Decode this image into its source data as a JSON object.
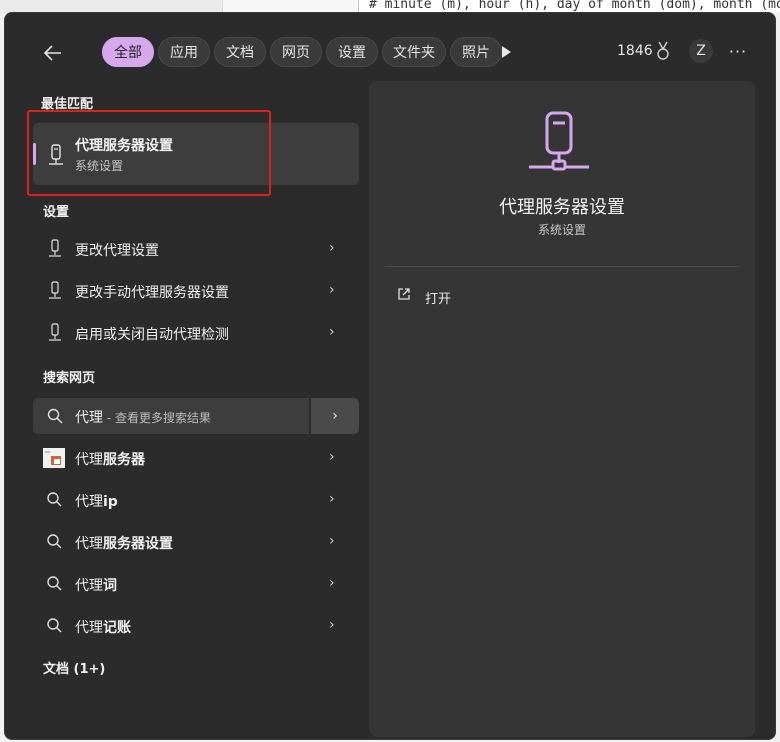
{
  "background": {
    "editor_line": "# minute (m), hour (h), day of month (dom), month (mon)"
  },
  "header": {
    "tabs": [
      {
        "label": "全部",
        "active": true
      },
      {
        "label": "应用",
        "active": false
      },
      {
        "label": "文档",
        "active": false
      },
      {
        "label": "网页",
        "active": false
      },
      {
        "label": "设置",
        "active": false
      },
      {
        "label": "文件夹",
        "active": false
      },
      {
        "label": "照片",
        "active": false
      }
    ],
    "points": "1846",
    "avatar_letter": "Z",
    "more": "···"
  },
  "sections": {
    "best_match": "最佳匹配",
    "settings": "设置",
    "web": "搜索网页",
    "documents": "文档 (1+)"
  },
  "best_match": {
    "title": "代理服务器设置",
    "subtitle": "系统设置"
  },
  "settings_items": [
    {
      "label": "更改代理设置"
    },
    {
      "label": "更改手动代理服务器设置"
    },
    {
      "label": "启用或关闭自动代理检测"
    }
  ],
  "web_search": {
    "query": "代理",
    "hint": " - 查看更多搜索结果"
  },
  "web_items": [
    {
      "prefix": "代理",
      "suffix": "服务器",
      "icon": "web-thumbnail-icon"
    },
    {
      "prefix": "代理",
      "suffix": "ip",
      "icon": "search-icon"
    },
    {
      "prefix": "代理",
      "suffix": "服务器设置",
      "icon": "search-icon"
    },
    {
      "prefix": "代理",
      "suffix": "词",
      "icon": "search-icon"
    },
    {
      "prefix": "代理",
      "suffix": "记账",
      "icon": "search-icon"
    }
  ],
  "preview": {
    "title": "代理服务器设置",
    "subtitle": "系统设置",
    "open_label": "打开"
  },
  "colors": {
    "accent": "#d8a8ef",
    "panel": "#2b2b2b",
    "highlight": "#e02020"
  }
}
